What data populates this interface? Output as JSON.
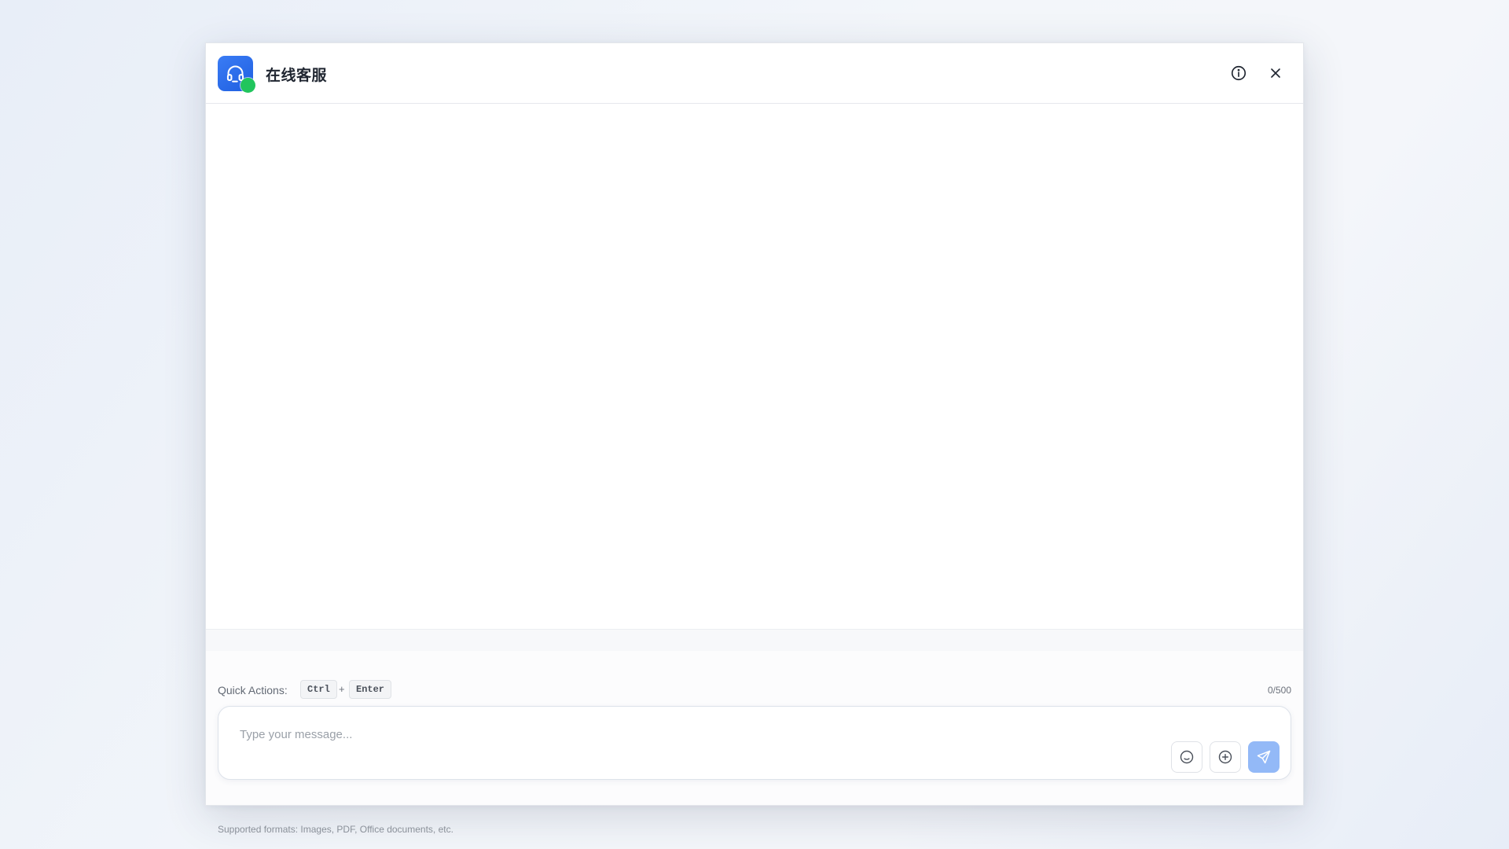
{
  "header": {
    "title": "在线客服",
    "avatar_icon": "headset-icon",
    "status": "online",
    "status_color": "#21c55d",
    "brand_color": "#2563eb",
    "info_icon": "info-icon",
    "close_icon": "close-icon"
  },
  "composer": {
    "quick_actions_label": "Quick Actions:",
    "shortcut_key_1": "Ctrl",
    "shortcut_plus": "+",
    "shortcut_key_2": "Enter",
    "char_count": "0/500",
    "input_value": "",
    "input_placeholder": "Type your message...",
    "emoji_icon": "smile-icon",
    "attach_icon": "plus-circle-icon",
    "send_icon": "send-icon",
    "send_color": "#93b9f7",
    "formats_note": "Supported formats: Images, PDF, Office documents, etc."
  }
}
